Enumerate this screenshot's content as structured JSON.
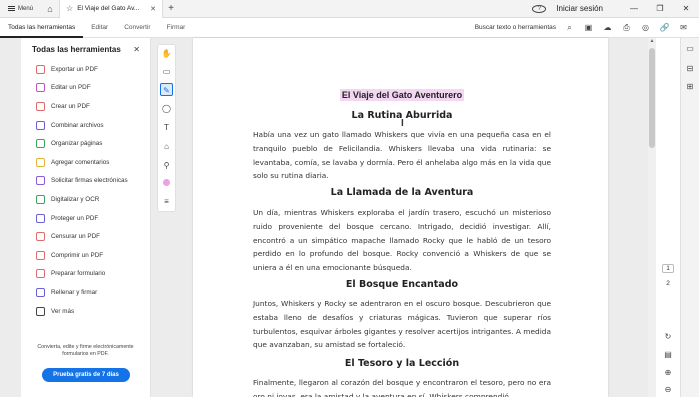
{
  "titlebar": {
    "menu_label": "Menú",
    "tab_title": "El Viaje del Gato Av...",
    "signin_label": "Iniciar sesión"
  },
  "toolbar": {
    "tabs": [
      "Todas las herramientas",
      "Editar",
      "Convertir",
      "Firmar"
    ],
    "search_label": "Buscar texto o herramientas"
  },
  "leftpanel": {
    "title": "Todas las herramientas",
    "tools": [
      {
        "label": "Exportar un PDF",
        "color": "#e06b6b"
      },
      {
        "label": "Editar un PDF",
        "color": "#c255b6"
      },
      {
        "label": "Crear un PDF",
        "color": "#e06b6b"
      },
      {
        "label": "Combinar archivos",
        "color": "#6b5fd6"
      },
      {
        "label": "Organizar páginas",
        "color": "#3da35d"
      },
      {
        "label": "Agregar comentarios",
        "color": "#e8b33a"
      },
      {
        "label": "Solicitar firmas electrónicas",
        "color": "#8a5cd6"
      },
      {
        "label": "Digitalizar y OCR",
        "color": "#3da35d"
      },
      {
        "label": "Proteger un PDF",
        "color": "#6b5fd6"
      },
      {
        "label": "Censurar un PDF",
        "color": "#e06b6b"
      },
      {
        "label": "Comprimir un PDF",
        "color": "#e06b6b"
      },
      {
        "label": "Preparar formulario",
        "color": "#e06b6b"
      },
      {
        "label": "Rellenar y firmar",
        "color": "#6b5fd6"
      },
      {
        "label": "Ver más",
        "color": "#444444"
      }
    ],
    "footer_text": "Convierta, edite y firme electrónicamente formularios en PDF.",
    "trial_button": "Prueba gratis de 7 días"
  },
  "document": {
    "title": "El Viaje del Gato Aventurero",
    "sections": [
      {
        "heading": "La Rutina Aburrida",
        "body": "Había una vez un gato llamado Whiskers que vivía en una pequeña casa en el tranquilo pueblo de Felicilandia. Whiskers llevaba una vida rutinaria: se levantaba, comía, se lavaba y dormía. Pero él anhelaba algo más en la vida que solo su rutina diaria."
      },
      {
        "heading": "La Llamada de la Aventura",
        "body": "Un día, mientras Whiskers exploraba el jardín trasero, escuchó un misterioso ruido proveniente del bosque cercano. Intrigado, decidió investigar. Allí, encontró a un simpático mapache llamado Rocky que le habló de un tesoro perdido en lo profundo del bosque. Rocky convenció a Whiskers de que se uniera a él en una emocionante búsqueda."
      },
      {
        "heading": "El Bosque Encantado",
        "body": "Juntos, Whiskers y Rocky se adentraron en el oscuro bosque. Descubrieron que estaba lleno de desafíos y criaturas mágicas. Tuvieron que superar ríos turbulentos, esquivar árboles gigantes y resolver acertijos intrigantes. A medida que avanzaban, su amistad se fortaleció."
      },
      {
        "heading": "El Tesoro y la Lección",
        "body": "Finalmente, llegaron al corazón del bosque y encontraron el tesoro, pero no era oro ni joyas, era la amistad y la aventura en sí. Whiskers comprendió"
      }
    ]
  },
  "pagination": {
    "current": "1",
    "next": "2"
  },
  "colors": {
    "accent": "#1473e6",
    "highlight": "#f3d6f1"
  }
}
